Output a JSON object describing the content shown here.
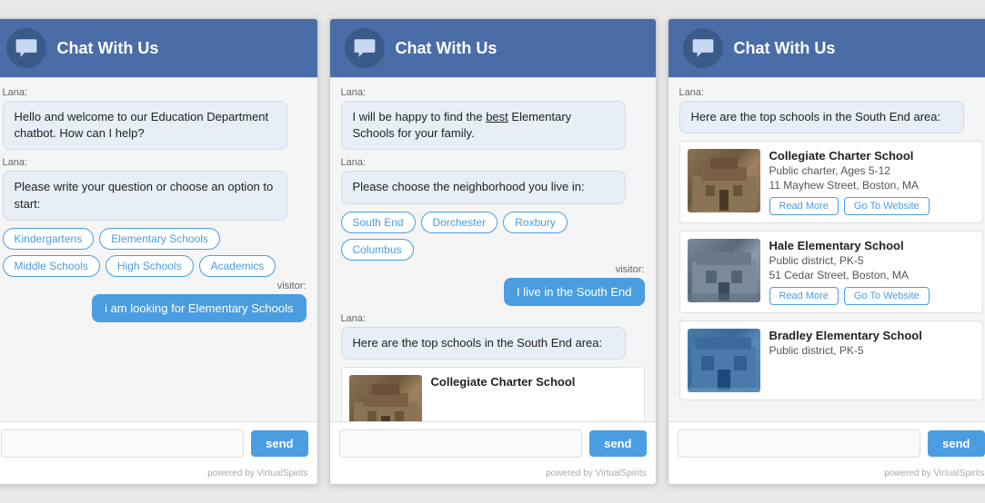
{
  "widgets": [
    {
      "id": "widget1",
      "header": {
        "title": "Chat With Us"
      },
      "messages": [
        {
          "type": "lana",
          "label": "Lana:",
          "text": "Hello and welcome to our Education Department chatbot. How can I help?"
        },
        {
          "type": "lana",
          "label": "Lana:",
          "text": "Please write your question or choose an option to start:"
        },
        {
          "type": "options",
          "buttons": [
            "Kindergartens",
            "Elementary Schools",
            "Middle Schools",
            "High Schools",
            "Academics"
          ]
        },
        {
          "type": "visitor",
          "label": "visitor:",
          "text": "i am looking for Elementary Schools"
        }
      ],
      "input_placeholder": "",
      "send_label": "send",
      "powered_by": "powered by VirtualSpirits"
    },
    {
      "id": "widget2",
      "header": {
        "title": "Chat With Us"
      },
      "messages": [
        {
          "type": "lana",
          "label": "Lana:",
          "text": "I will be happy to find the best Elementary Schools for your family."
        },
        {
          "type": "lana",
          "label": "Lana:",
          "text": "Please choose the neighborhood you live in:"
        },
        {
          "type": "options",
          "buttons": [
            "South End",
            "Dorchester",
            "Roxbury",
            "Columbus"
          ]
        },
        {
          "type": "visitor",
          "label": "visitor:",
          "text": "I live in the South End"
        },
        {
          "type": "lana",
          "label": "Lana:",
          "text": "Here are the top schools in the South End area:"
        },
        {
          "type": "school_partial",
          "name": "Collegiate Charter School",
          "image_class": "building1"
        }
      ],
      "input_placeholder": "",
      "send_label": "send",
      "powered_by": "powered by VirtualSpirits"
    },
    {
      "id": "widget3",
      "header": {
        "title": "Chat With Us"
      },
      "messages": [
        {
          "type": "lana",
          "label": "Lana:",
          "text": "Here are the top schools in the South End area:"
        },
        {
          "type": "school_full",
          "name": "Collegiate Charter School",
          "school_type": "Public charter, Ages 5-12",
          "address": "11 Mayhew Street, Boston, MA",
          "read_more": "Read More",
          "go_to_website": "Go To Website",
          "image_class": "building1"
        },
        {
          "type": "school_full",
          "name": "Hale Elementary School",
          "school_type": "Public district, PK-5",
          "address": "51 Cedar Street, Boston, MA",
          "read_more": "Read More",
          "go_to_website": "Go To Website",
          "image_class": "building2"
        },
        {
          "type": "school_partial_name",
          "name": "Bradley Elementary School",
          "school_type": "Public district, PK-5",
          "image_class": "building3"
        }
      ],
      "input_placeholder": "",
      "send_label": "send",
      "powered_by": "powered by VirtualSpirits"
    }
  ]
}
